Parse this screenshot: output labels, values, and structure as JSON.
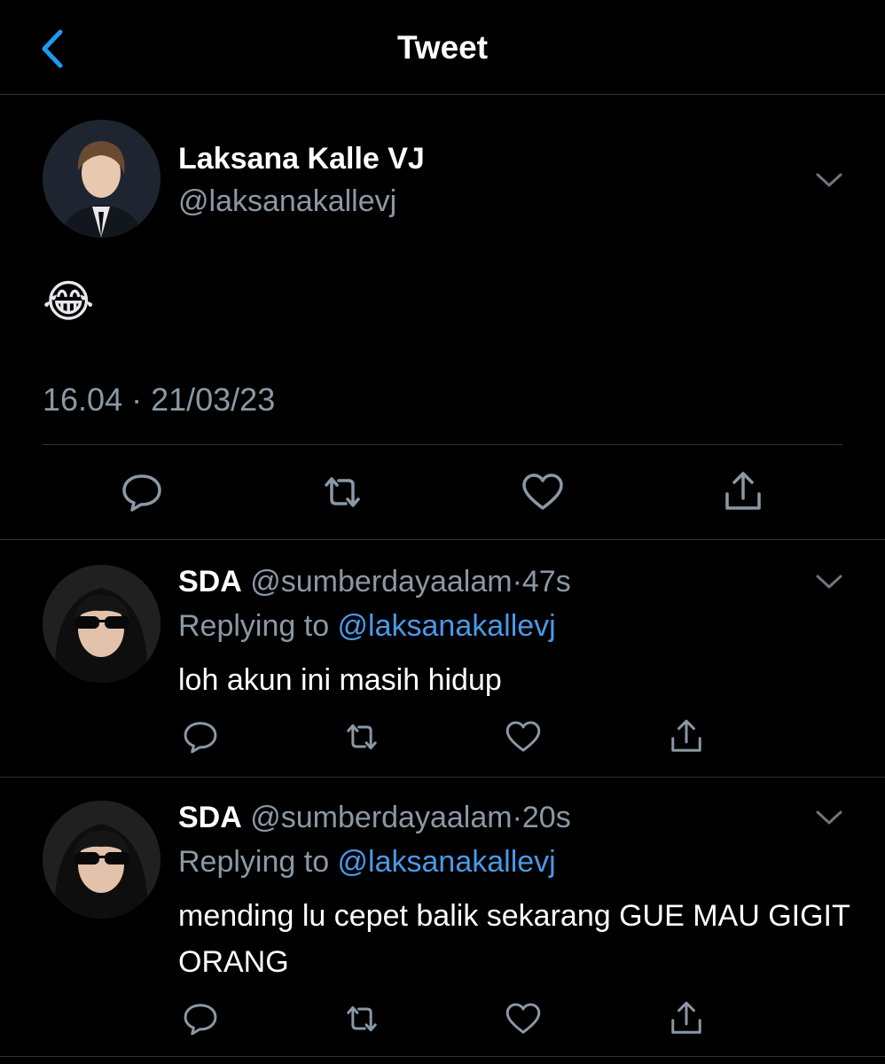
{
  "header": {
    "title": "Tweet",
    "back_icon": "chevron-left-icon",
    "accent": "#1d9bf0"
  },
  "main_tweet": {
    "author_name": "Laksana Kalle VJ",
    "author_handle": "@laksanakallevj",
    "text": "😂",
    "timestamp": "16.04 · 21/03/23",
    "actions": [
      "reply-icon",
      "retweet-icon",
      "like-icon",
      "share-icon"
    ]
  },
  "replies": [
    {
      "author_name": "SDA",
      "author_handle": "@sumberdayaalam",
      "dot": "·",
      "time": "47s",
      "replying_prefix": "Replying to ",
      "replying_to": "@laksanakallevj",
      "text": "loh akun ini masih hidup"
    },
    {
      "author_name": "SDA",
      "author_handle": "@sumberdayaalam",
      "dot": "·",
      "time": "20s",
      "replying_prefix": "Replying to ",
      "replying_to": "@laksanakallevj",
      "text": "mending lu cepet balik sekarang GUE MAU GIGIT ORANG"
    }
  ],
  "colors": {
    "background": "#000000",
    "divider": "#2f3336",
    "muted_text": "#8b98a5",
    "mention": "#4a99e9"
  }
}
